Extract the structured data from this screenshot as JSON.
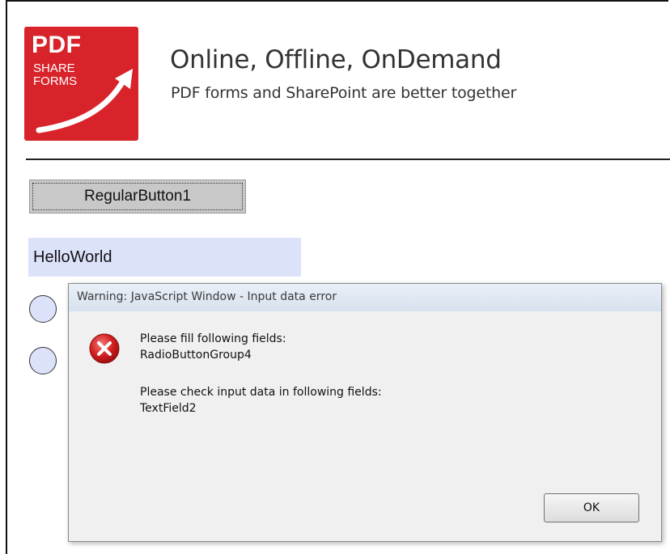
{
  "logo": {
    "line1": "PDF",
    "line2": "SHARE",
    "line3": "FORMS",
    "color": "#d8232a"
  },
  "header": {
    "title": "Online, Offline, OnDemand",
    "subtitle": "PDF forms and SharePoint are better together"
  },
  "form": {
    "button_label": "RegularButton1",
    "text_field_value": "HelloWorld",
    "field_fill_color": "#dde2fb"
  },
  "dialog": {
    "title": "Warning: JavaScript Window - Input data error",
    "icon": "error-icon",
    "message_fill_header": "Please fill following fields:",
    "message_fill_field": "RadioButtonGroup4",
    "message_check_header": "Please check input data in following fields:",
    "message_check_field": "TextField2",
    "ok_label": "OK"
  }
}
